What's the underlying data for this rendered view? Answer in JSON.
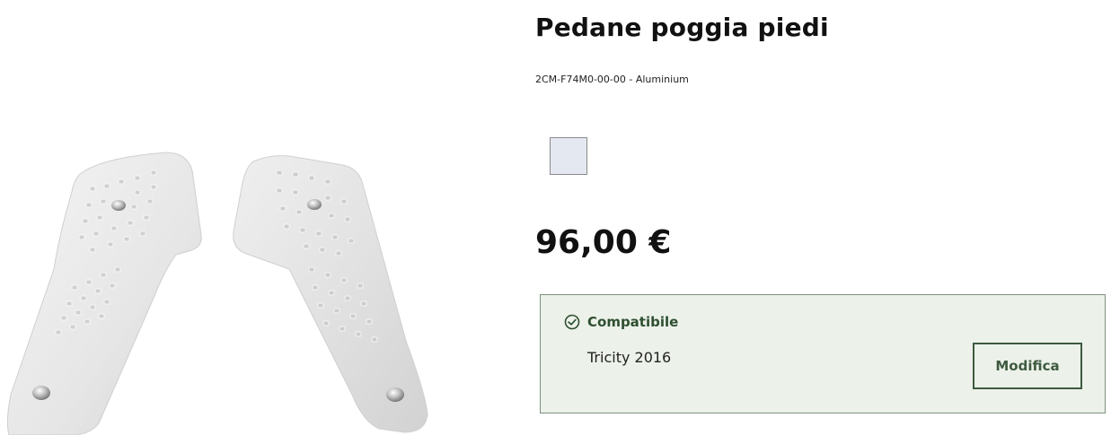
{
  "product": {
    "title": "Pedane poggia piedi",
    "sku": "2CM-F74M0-00-00 - Aluminium",
    "image_icon": "footrest-plates-image",
    "color_options": [
      {
        "name": "Aluminium",
        "color": "#e4e9f1",
        "selected": true
      }
    ],
    "price": "96,00 €"
  },
  "compatibility": {
    "icon": "check-circle-icon",
    "label": "Compatibile",
    "model": "Tricity 2016",
    "modify_label": "Modifica",
    "accent_color": "#3e5a3f",
    "background_color": "#ecf1ea"
  }
}
